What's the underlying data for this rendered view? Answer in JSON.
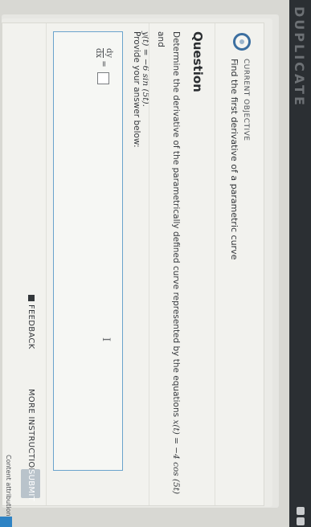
{
  "brand": {
    "text": "DUPLICATE"
  },
  "objective": {
    "kicker": "CURRENT OBJECTIVE",
    "text": "Find the first derivative of a parametric curve"
  },
  "question": {
    "title": "Question",
    "line1_prefix": "Determine the derivative of the parametrically defined curve represented by the equations",
    "x_eq": "x(t) = −4 cos (5t)",
    "and": "and",
    "y_eq": "y(t) = −6 sin (5t)."
  },
  "answer": {
    "prompt": "Provide your answer below:",
    "lhs_num": "dy",
    "lhs_den": "dx",
    "equals": "="
  },
  "buttons": {
    "feedback": "FEEDBACK",
    "more_instruction": "MORE INSTRUCTION",
    "submit": "SUBMIT"
  },
  "footer": {
    "attribution": "Content attribution"
  },
  "colors": {
    "accent": "#2e83c4",
    "answer_border": "#6aa3cc",
    "submit_bg": "#b9c3cb",
    "topbar": "#2b2f33"
  }
}
